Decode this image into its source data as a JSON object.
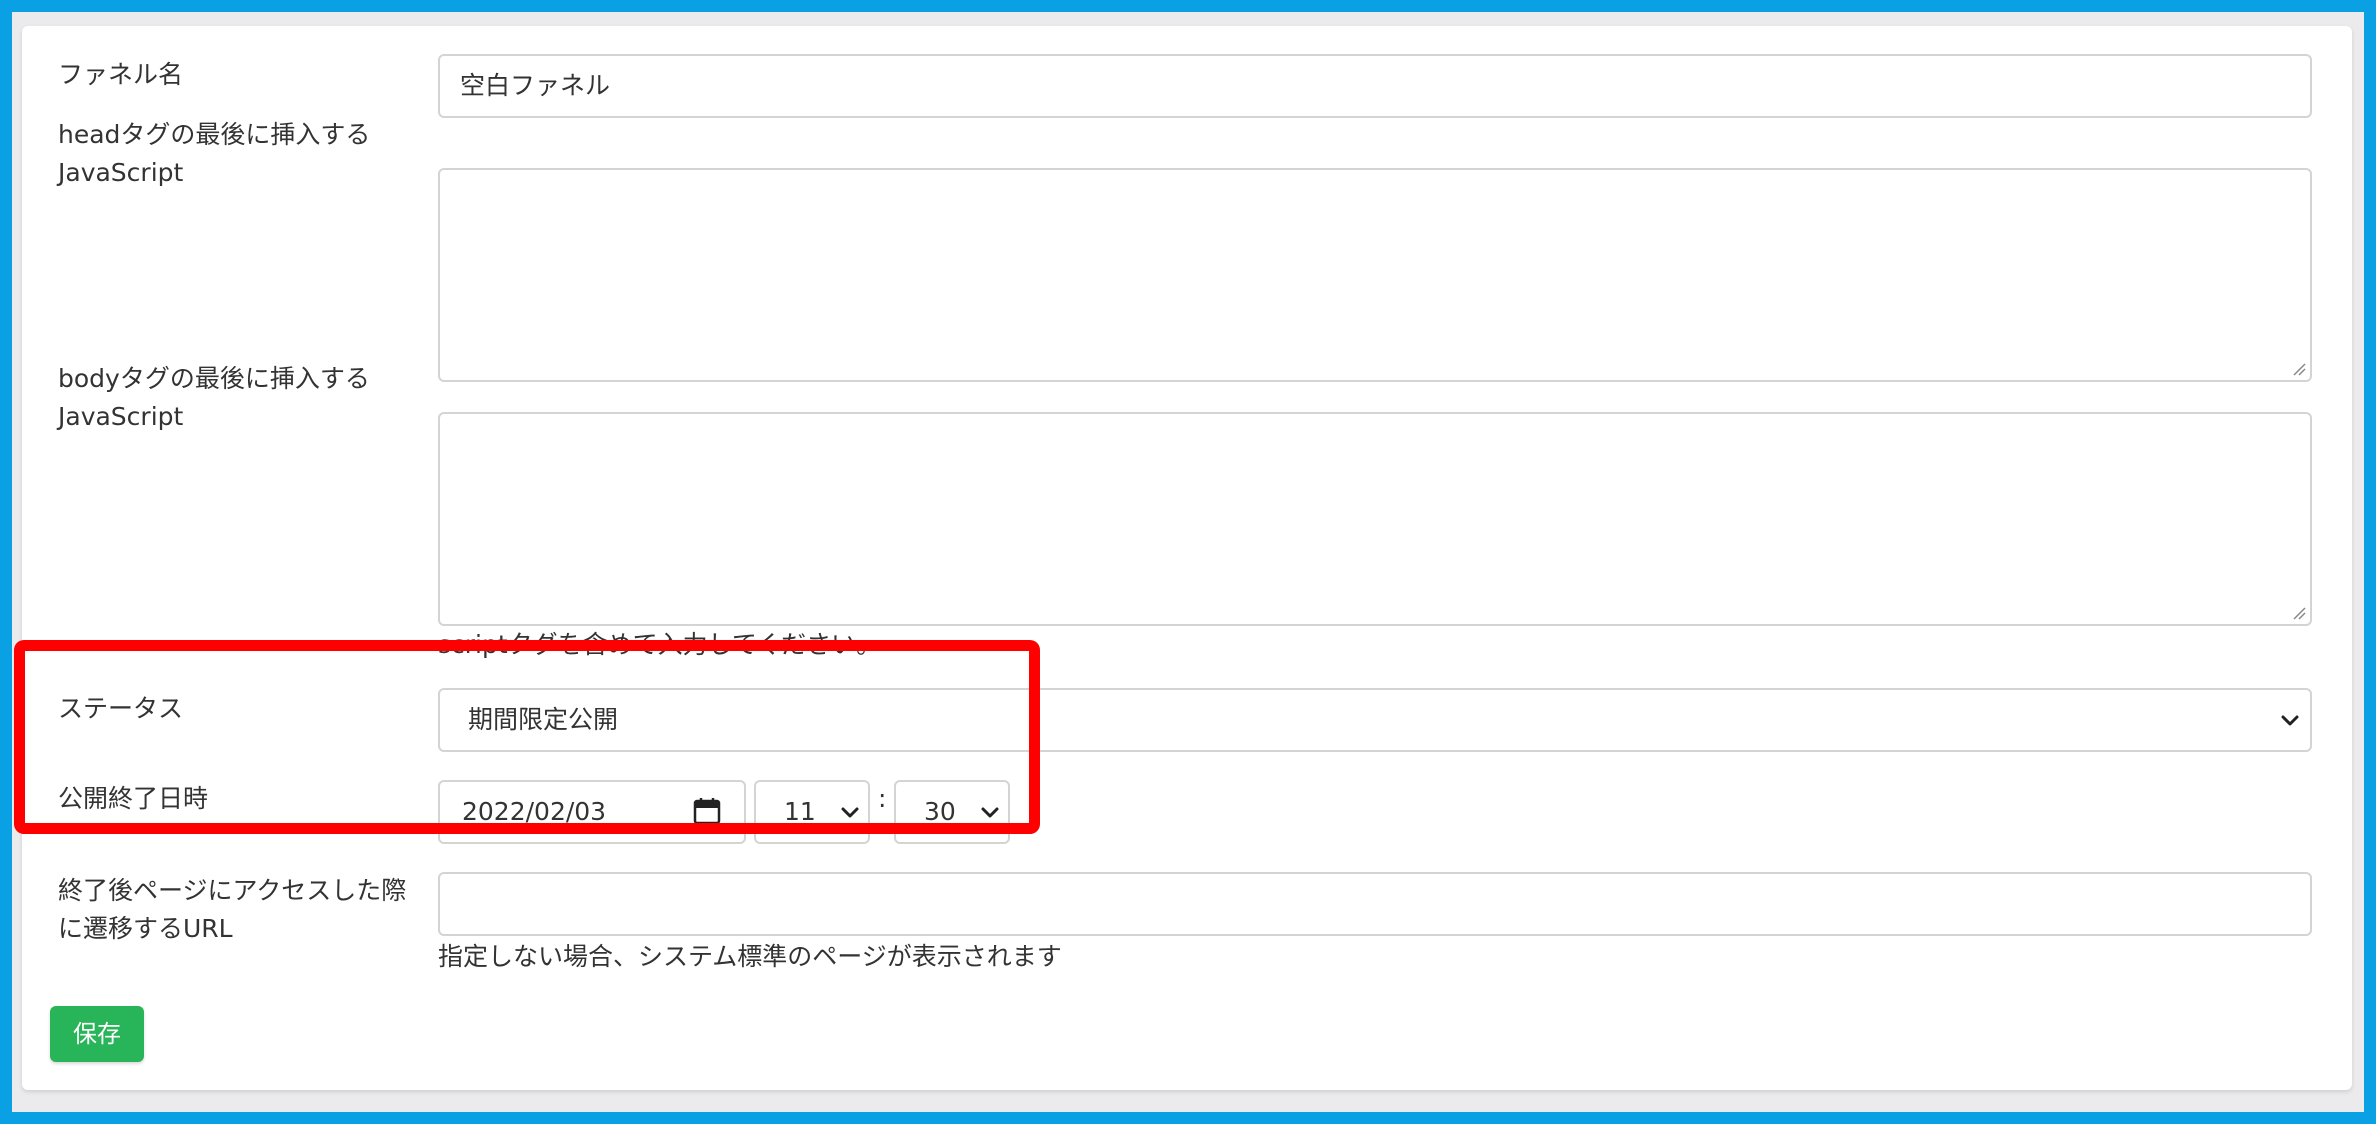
{
  "form": {
    "funnel_name": {
      "label": "ファネル名",
      "value": "空白ファネル"
    },
    "head_js": {
      "label_line1": "headタグの最後に挿入する",
      "label_line2": "JavaScript",
      "value": ""
    },
    "body_js": {
      "label_line1": "bodyタグの最後に挿入する",
      "label_line2": "JavaScript",
      "value": "",
      "help": "scriptタグを含めて入力してください。"
    },
    "status": {
      "label": "ステータス",
      "selected": "期間限定公開"
    },
    "end_datetime": {
      "label": "公開終了日時",
      "date": "2022/02/03",
      "hour": "11",
      "separator": ":",
      "minute": "30"
    },
    "redirect_url": {
      "label_line1": "終了後ページにアクセスした際",
      "label_line2": "に遷移するURL",
      "value": "",
      "help": "指定しない場合、システム標準のページが表示されます"
    },
    "save_label": "保存"
  },
  "colors": {
    "outer_frame": "#0aa0e4",
    "highlight": "#ff0000",
    "save_button": "#28b459"
  },
  "icons": [
    "calendar-icon",
    "chevron-down-icon",
    "resize-grip-icon"
  ]
}
